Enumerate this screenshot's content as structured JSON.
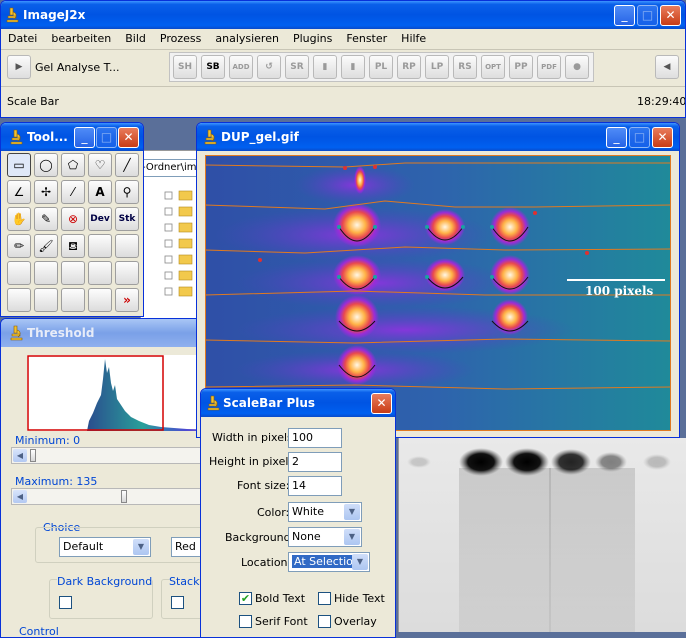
{
  "main": {
    "title": "ImageJ2x",
    "menu": [
      "Datei",
      "bearbeiten",
      "Bild",
      "Prozess",
      "analysieren",
      "Plugins",
      "Fenster",
      "Hilfe"
    ],
    "toolset_label": "Gel Analyse T...",
    "toolbar": [
      "SH",
      "SB",
      "ADD",
      "↺",
      "SR",
      "▮",
      "▮",
      "PL",
      "RP",
      "LP",
      "RS",
      "OPT",
      "PP",
      "PDF",
      "●"
    ],
    "status": "Scale Bar",
    "time": "18:29:40"
  },
  "tools": {
    "title": "Tool..."
  },
  "browser": {
    "path": "-Ordner\\im"
  },
  "gel": {
    "title": "DUP_gel.gif",
    "scalebar_label": "100 pixels",
    "scalebar_color": "#ffffff"
  },
  "threshold": {
    "title": "Threshold",
    "min_label": "Minimum: 0",
    "max_label": "Maximum: 135",
    "choice_label": "Choice",
    "method": "Default",
    "mode": "Red",
    "dark_bg_label": "Dark Background",
    "stack_label": "Stack",
    "control_label": "Control",
    "max_fraction": 0.53
  },
  "scalebar": {
    "title": "ScaleBar Plus",
    "width_label": "Width in pixels:",
    "width_value": "100",
    "height_label": "Height in pixels:",
    "height_value": "2",
    "font_label": "Font size:",
    "font_value": "14",
    "color_label": "Color:",
    "color_value": "White",
    "bg_label": "Background:",
    "bg_value": "None",
    "loc_label": "Location:",
    "loc_value": "At Selection",
    "bold_label": "Bold Text",
    "hide_label": "Hide Text",
    "serif_label": "Serif Font",
    "overlay_label": "Overlay",
    "bold_checked": true
  }
}
